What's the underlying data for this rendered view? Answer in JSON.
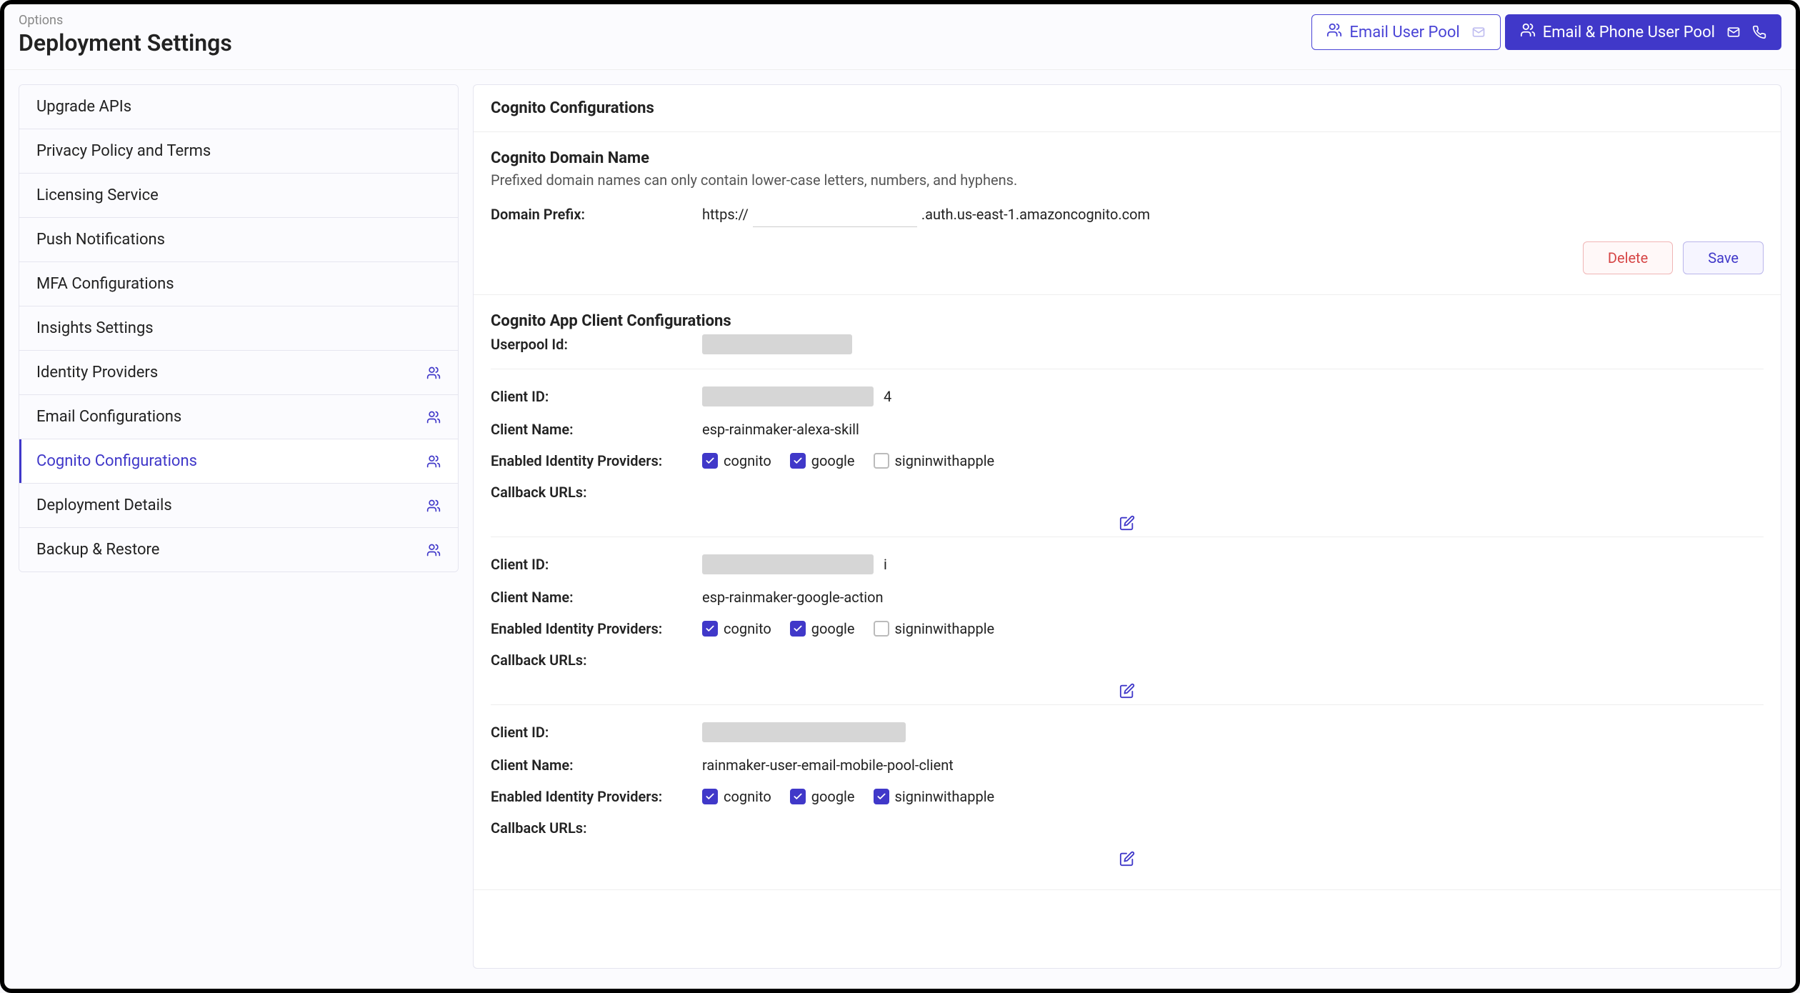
{
  "header": {
    "eyebrow": "Options",
    "title": "Deployment Settings"
  },
  "pool_buttons": {
    "email": "Email User Pool",
    "email_phone": "Email & Phone User Pool"
  },
  "sidebar": {
    "items": [
      {
        "label": "Upgrade APIs",
        "icon": false,
        "active": false
      },
      {
        "label": "Privacy Policy and Terms",
        "icon": false,
        "active": false
      },
      {
        "label": "Licensing Service",
        "icon": false,
        "active": false
      },
      {
        "label": "Push Notifications",
        "icon": false,
        "active": false
      },
      {
        "label": "MFA Configurations",
        "icon": false,
        "active": false
      },
      {
        "label": "Insights Settings",
        "icon": false,
        "active": false
      },
      {
        "label": "Identity Providers",
        "icon": true,
        "active": false
      },
      {
        "label": "Email Configurations",
        "icon": true,
        "active": false
      },
      {
        "label": "Cognito Configurations",
        "icon": true,
        "active": true
      },
      {
        "label": "Deployment Details",
        "icon": true,
        "active": false
      },
      {
        "label": "Backup & Restore",
        "icon": true,
        "active": false
      }
    ]
  },
  "main": {
    "title": "Cognito Configurations",
    "domain": {
      "heading": "Cognito Domain Name",
      "sub": "Prefixed domain names can only contain lower-case letters, numbers, and hyphens.",
      "label": "Domain Prefix:",
      "prefix": "https://",
      "value": "",
      "suffix": ".auth.us-east-1.amazoncognito.com",
      "delete": "Delete",
      "save": "Save"
    },
    "app": {
      "heading": "Cognito App Client Configurations",
      "userpool_label": "Userpool Id:",
      "client_id_label": "Client ID:",
      "client_name_label": "Client Name:",
      "providers_label": "Enabled Identity Providers:",
      "callback_label": "Callback URLs:",
      "provider_names": {
        "cognito": "cognito",
        "google": "google",
        "apple": "signinwithapple"
      },
      "clients": [
        {
          "id_trailing": "4",
          "name": "esp-rainmaker-alexa-skill",
          "cognito": true,
          "google": true,
          "apple": false
        },
        {
          "id_trailing": "i",
          "name": "esp-rainmaker-google-action",
          "cognito": true,
          "google": true,
          "apple": false
        },
        {
          "id_trailing": "",
          "name": "rainmaker-user-email-mobile-pool-client",
          "cognito": true,
          "google": true,
          "apple": true
        }
      ]
    }
  }
}
